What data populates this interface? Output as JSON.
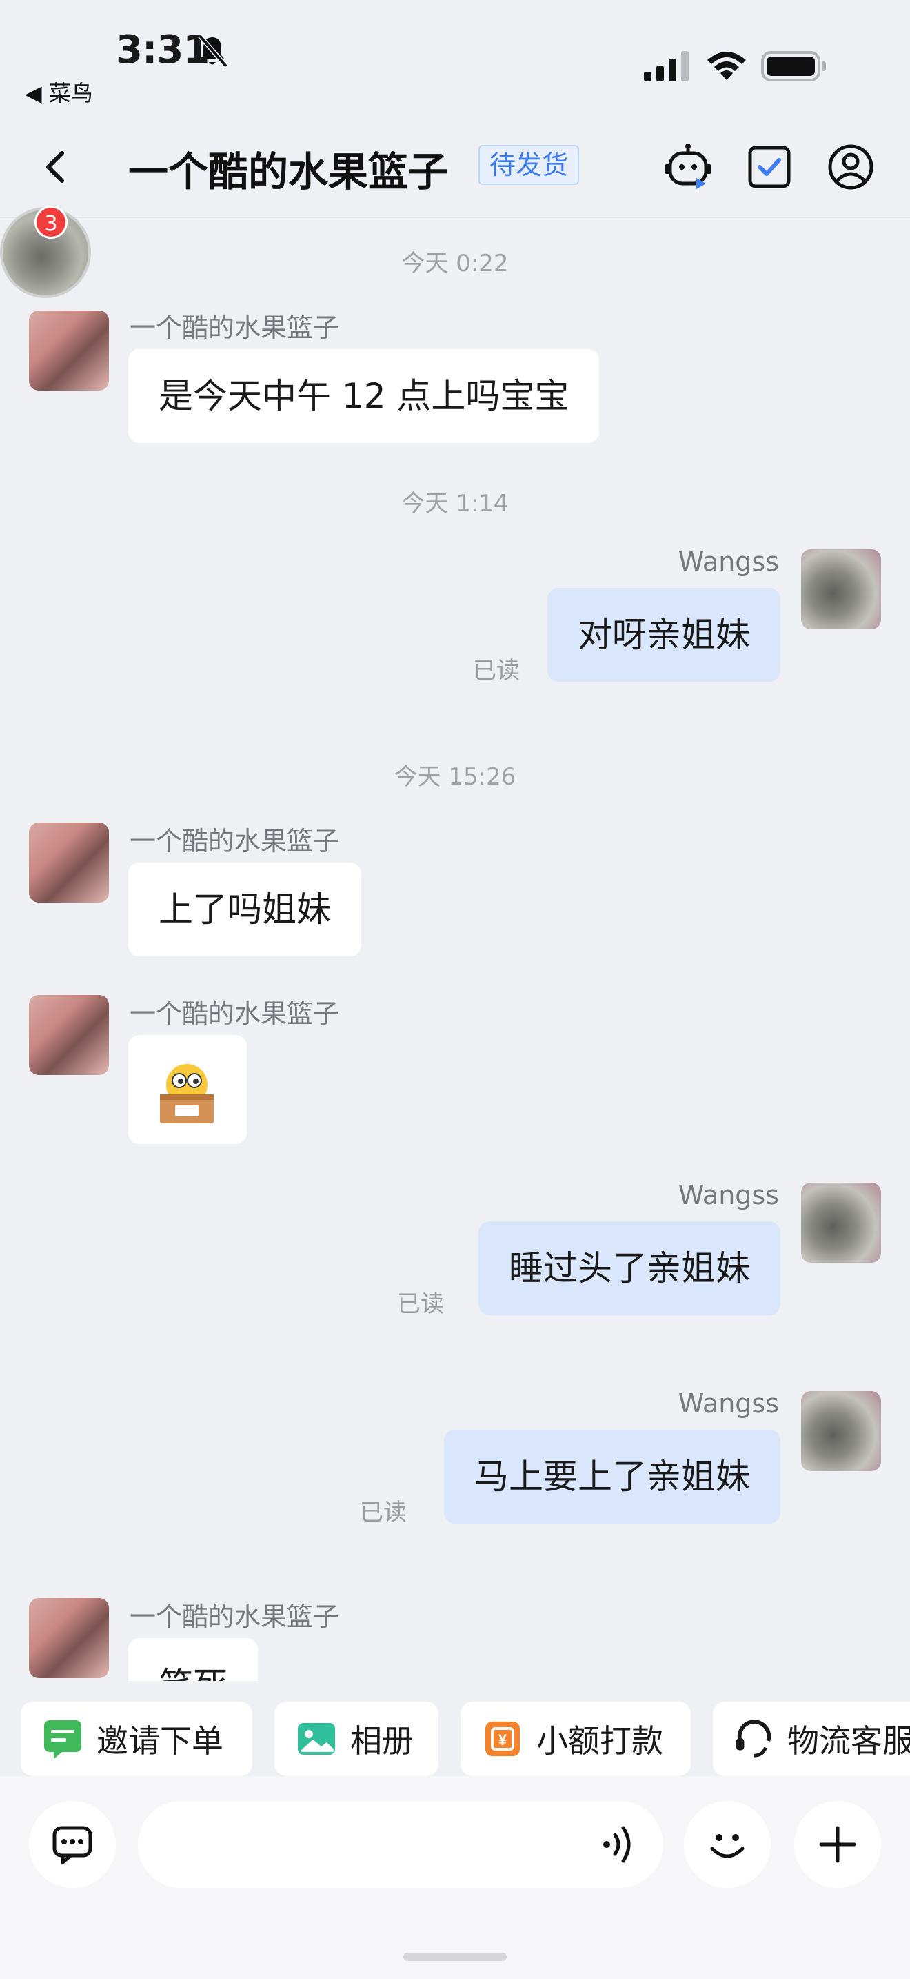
{
  "status_bar": {
    "time": "3:31",
    "back_app": "◀ 菜鸟"
  },
  "nav": {
    "title": "一个酷的水果篮子",
    "badge": "待发货"
  },
  "float": {
    "badge_count": "3"
  },
  "messages": {
    "ts1": "今天 0:22",
    "m1_sender": "一个酷的水果篮子",
    "m1_text": "是今天中午 12 点上吗宝宝",
    "ts2": "今天 1:14",
    "m2_sender": "Wangss",
    "m2_text": "对呀亲姐妹",
    "m2_read": "已读",
    "ts3": "今天 15:26",
    "m3_sender": "一个酷的水果篮子",
    "m3_text": "上了吗姐妹",
    "m4_sender": "一个酷的水果篮子",
    "m5_sender": "Wangss",
    "m5_text": "睡过头了亲姐妹",
    "m5_read": "已读",
    "m6_sender": "Wangss",
    "m6_text": "马上要上了亲姐妹",
    "m6_read": "已读",
    "m7_sender": "一个酷的水果篮子",
    "m7_text": "笑死"
  },
  "quick_actions": [
    {
      "label": "邀请下单",
      "icon": "order-invite-icon",
      "color": "#3fb95a"
    },
    {
      "label": "相册",
      "icon": "photo-album-icon",
      "color": "#2fbf9a"
    },
    {
      "label": "小额打款",
      "icon": "small-payment-icon",
      "color": "#f5822a"
    },
    {
      "label": "物流客服",
      "icon": "logistics-service-icon",
      "color": "#1a1a1a"
    }
  ]
}
